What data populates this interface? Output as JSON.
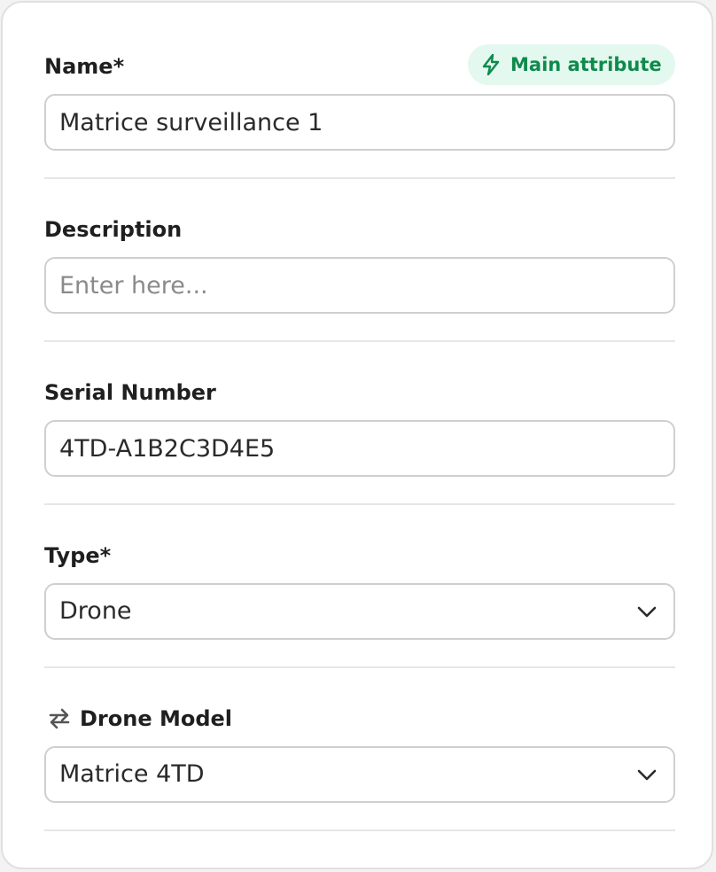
{
  "form": {
    "name": {
      "label": "Name*",
      "value": "Matrice surveillance 1",
      "badge": "Main attribute"
    },
    "description": {
      "label": "Description",
      "placeholder": "Enter here..."
    },
    "serial_number": {
      "label": "Serial Number",
      "value": "4TD-A1B2C3D4E5"
    },
    "type": {
      "label": "Type*",
      "selected": "Drone"
    },
    "drone_model": {
      "label": "Drone Model",
      "selected": "Matrice 4TD"
    }
  },
  "icons": {
    "badge_icon": "lightning-bolt-icon",
    "link_icon": "swap-arrows-icon",
    "dropdown_icon": "chevron-down-icon"
  },
  "colors": {
    "badge_bg": "#e3f8ee",
    "badge_text": "#0f8a4c",
    "border": "#cfcfcf",
    "divider": "#e6e6e6"
  }
}
